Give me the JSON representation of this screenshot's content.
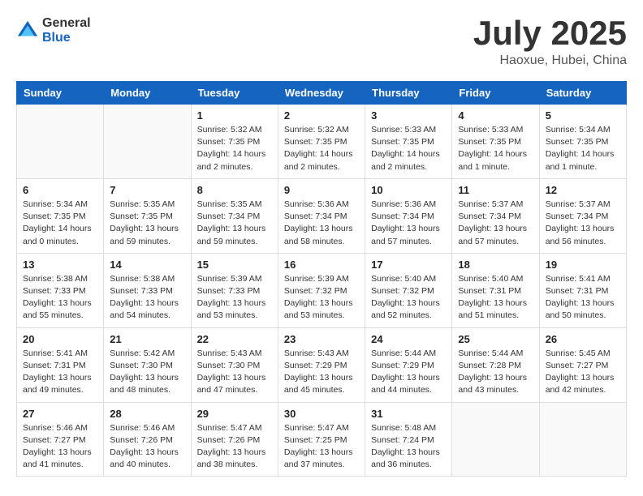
{
  "header": {
    "logo_general": "General",
    "logo_blue": "Blue",
    "month_title": "July 2025",
    "location": "Haoxue, Hubei, China"
  },
  "calendar": {
    "days_of_week": [
      "Sunday",
      "Monday",
      "Tuesday",
      "Wednesday",
      "Thursday",
      "Friday",
      "Saturday"
    ],
    "weeks": [
      [
        {
          "day": "",
          "info": ""
        },
        {
          "day": "",
          "info": ""
        },
        {
          "day": "1",
          "info": "Sunrise: 5:32 AM\nSunset: 7:35 PM\nDaylight: 14 hours\nand 2 minutes."
        },
        {
          "day": "2",
          "info": "Sunrise: 5:32 AM\nSunset: 7:35 PM\nDaylight: 14 hours\nand 2 minutes."
        },
        {
          "day": "3",
          "info": "Sunrise: 5:33 AM\nSunset: 7:35 PM\nDaylight: 14 hours\nand 2 minutes."
        },
        {
          "day": "4",
          "info": "Sunrise: 5:33 AM\nSunset: 7:35 PM\nDaylight: 14 hours\nand 1 minute."
        },
        {
          "day": "5",
          "info": "Sunrise: 5:34 AM\nSunset: 7:35 PM\nDaylight: 14 hours\nand 1 minute."
        }
      ],
      [
        {
          "day": "6",
          "info": "Sunrise: 5:34 AM\nSunset: 7:35 PM\nDaylight: 14 hours\nand 0 minutes."
        },
        {
          "day": "7",
          "info": "Sunrise: 5:35 AM\nSunset: 7:35 PM\nDaylight: 13 hours\nand 59 minutes."
        },
        {
          "day": "8",
          "info": "Sunrise: 5:35 AM\nSunset: 7:34 PM\nDaylight: 13 hours\nand 59 minutes."
        },
        {
          "day": "9",
          "info": "Sunrise: 5:36 AM\nSunset: 7:34 PM\nDaylight: 13 hours\nand 58 minutes."
        },
        {
          "day": "10",
          "info": "Sunrise: 5:36 AM\nSunset: 7:34 PM\nDaylight: 13 hours\nand 57 minutes."
        },
        {
          "day": "11",
          "info": "Sunrise: 5:37 AM\nSunset: 7:34 PM\nDaylight: 13 hours\nand 57 minutes."
        },
        {
          "day": "12",
          "info": "Sunrise: 5:37 AM\nSunset: 7:34 PM\nDaylight: 13 hours\nand 56 minutes."
        }
      ],
      [
        {
          "day": "13",
          "info": "Sunrise: 5:38 AM\nSunset: 7:33 PM\nDaylight: 13 hours\nand 55 minutes."
        },
        {
          "day": "14",
          "info": "Sunrise: 5:38 AM\nSunset: 7:33 PM\nDaylight: 13 hours\nand 54 minutes."
        },
        {
          "day": "15",
          "info": "Sunrise: 5:39 AM\nSunset: 7:33 PM\nDaylight: 13 hours\nand 53 minutes."
        },
        {
          "day": "16",
          "info": "Sunrise: 5:39 AM\nSunset: 7:32 PM\nDaylight: 13 hours\nand 53 minutes."
        },
        {
          "day": "17",
          "info": "Sunrise: 5:40 AM\nSunset: 7:32 PM\nDaylight: 13 hours\nand 52 minutes."
        },
        {
          "day": "18",
          "info": "Sunrise: 5:40 AM\nSunset: 7:31 PM\nDaylight: 13 hours\nand 51 minutes."
        },
        {
          "day": "19",
          "info": "Sunrise: 5:41 AM\nSunset: 7:31 PM\nDaylight: 13 hours\nand 50 minutes."
        }
      ],
      [
        {
          "day": "20",
          "info": "Sunrise: 5:41 AM\nSunset: 7:31 PM\nDaylight: 13 hours\nand 49 minutes."
        },
        {
          "day": "21",
          "info": "Sunrise: 5:42 AM\nSunset: 7:30 PM\nDaylight: 13 hours\nand 48 minutes."
        },
        {
          "day": "22",
          "info": "Sunrise: 5:43 AM\nSunset: 7:30 PM\nDaylight: 13 hours\nand 47 minutes."
        },
        {
          "day": "23",
          "info": "Sunrise: 5:43 AM\nSunset: 7:29 PM\nDaylight: 13 hours\nand 45 minutes."
        },
        {
          "day": "24",
          "info": "Sunrise: 5:44 AM\nSunset: 7:29 PM\nDaylight: 13 hours\nand 44 minutes."
        },
        {
          "day": "25",
          "info": "Sunrise: 5:44 AM\nSunset: 7:28 PM\nDaylight: 13 hours\nand 43 minutes."
        },
        {
          "day": "26",
          "info": "Sunrise: 5:45 AM\nSunset: 7:27 PM\nDaylight: 13 hours\nand 42 minutes."
        }
      ],
      [
        {
          "day": "27",
          "info": "Sunrise: 5:46 AM\nSunset: 7:27 PM\nDaylight: 13 hours\nand 41 minutes."
        },
        {
          "day": "28",
          "info": "Sunrise: 5:46 AM\nSunset: 7:26 PM\nDaylight: 13 hours\nand 40 minutes."
        },
        {
          "day": "29",
          "info": "Sunrise: 5:47 AM\nSunset: 7:26 PM\nDaylight: 13 hours\nand 38 minutes."
        },
        {
          "day": "30",
          "info": "Sunrise: 5:47 AM\nSunset: 7:25 PM\nDaylight: 13 hours\nand 37 minutes."
        },
        {
          "day": "31",
          "info": "Sunrise: 5:48 AM\nSunset: 7:24 PM\nDaylight: 13 hours\nand 36 minutes."
        },
        {
          "day": "",
          "info": ""
        },
        {
          "day": "",
          "info": ""
        }
      ]
    ]
  }
}
